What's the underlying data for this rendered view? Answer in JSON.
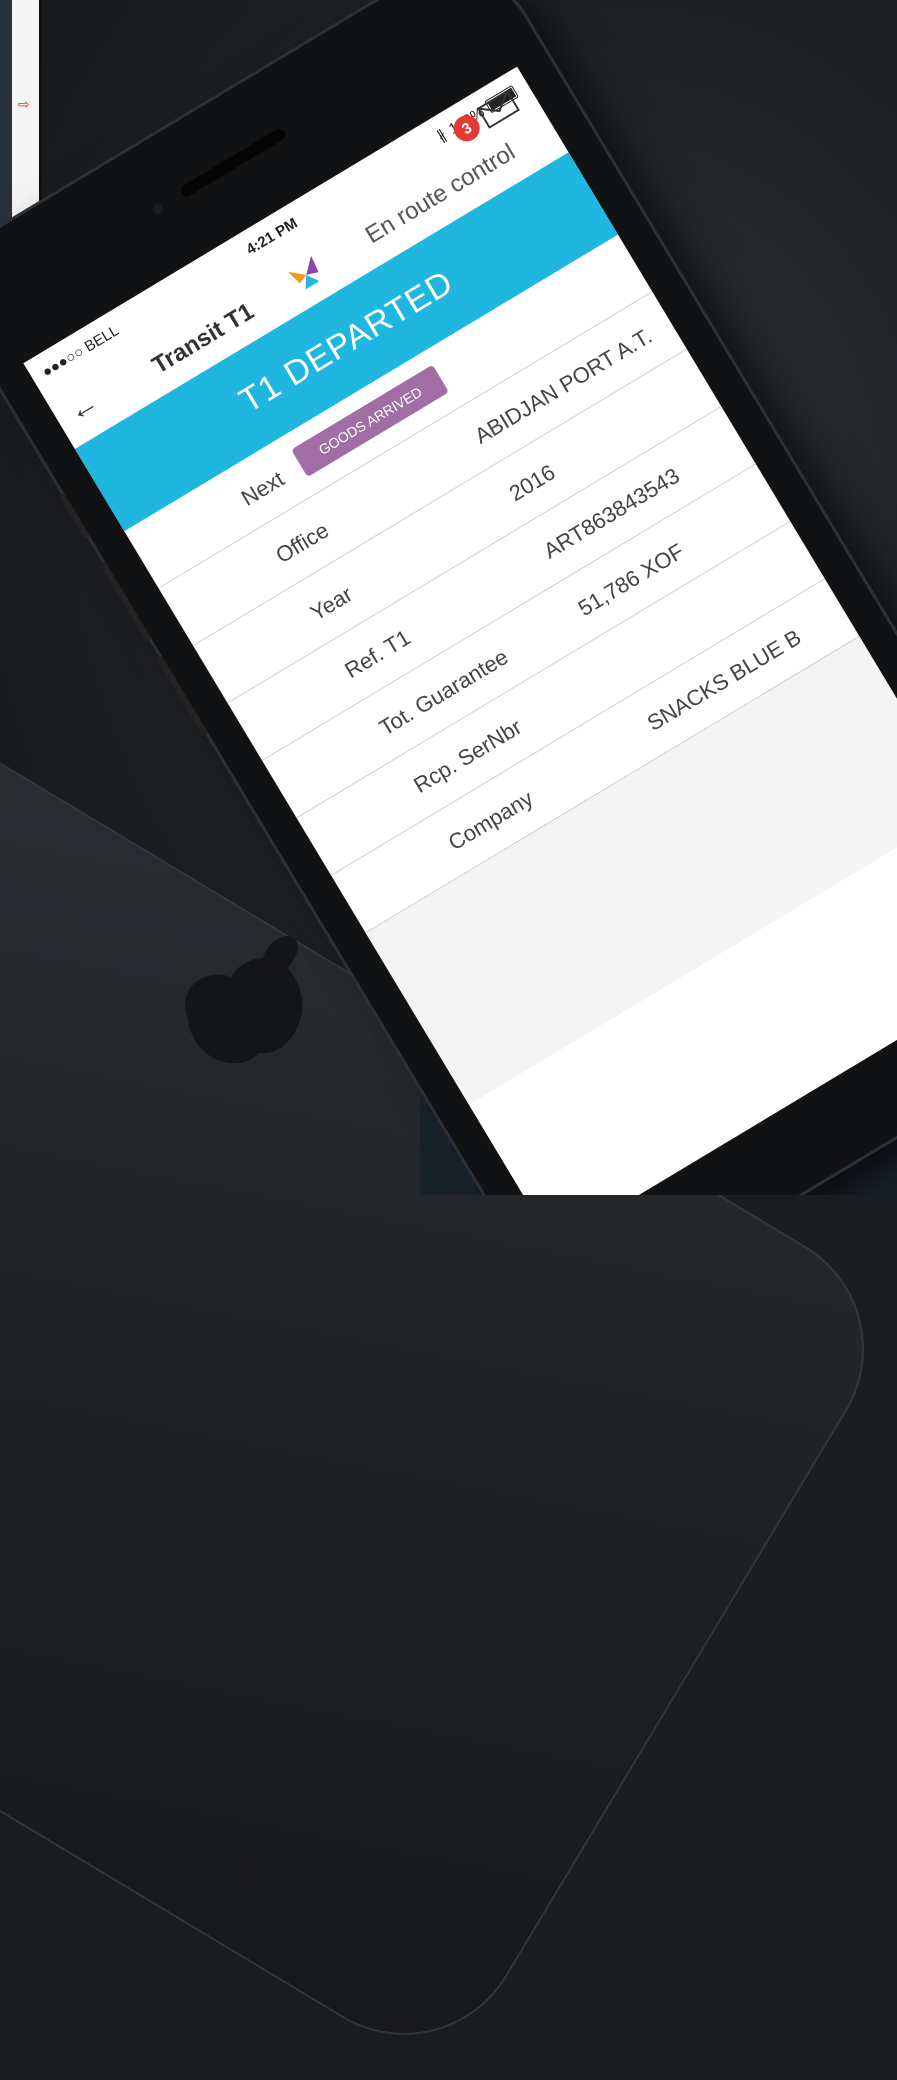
{
  "status_bar": {
    "carrier": "●●●○○ BELL",
    "time": "4:21 PM",
    "battery": "100%"
  },
  "nav": {
    "title": "Transit T1",
    "subtitle": "En route control",
    "back_icon": "back-arrow-icon",
    "mail_badge_count": "3"
  },
  "banner": {
    "text": "T1 DEPARTED"
  },
  "next": {
    "label": "Next",
    "status": "GOODS ARRIVED"
  },
  "fields": [
    {
      "label": "Office",
      "value": "ABIDJAN PORT A.T."
    },
    {
      "label": "Year",
      "value": "2016"
    },
    {
      "label": "Ref. T1",
      "value": "ART863843543"
    },
    {
      "label": "Tot. Guarantee",
      "value": "51,786 XOF"
    },
    {
      "label": "Rcp. SerNbr",
      "value": ""
    },
    {
      "label": "Company",
      "value": "SNACKS BLUE B"
    }
  ],
  "colors": {
    "banner": "#1fb6e0",
    "pill": "#a06da4",
    "badge": "#e53935"
  }
}
